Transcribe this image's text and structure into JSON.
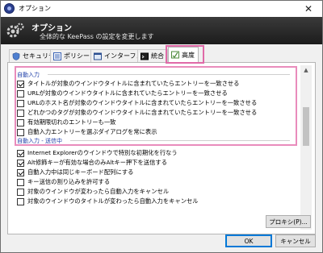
{
  "window": {
    "title": "オプション",
    "close_glyph": "✕"
  },
  "banner": {
    "title": "オプション",
    "subtitle": "全体的な KeePass の設定を変更します"
  },
  "tabs": [
    {
      "label": "セキュリティ",
      "icon": "shield-icon"
    },
    {
      "label": "ポリシー",
      "icon": "policy-icon"
    },
    {
      "label": "インターフェース",
      "icon": "interface-icon"
    },
    {
      "label": "統合",
      "icon": "integration-icon"
    },
    {
      "label": "高度",
      "icon": "advanced-icon",
      "active": true
    }
  ],
  "sections": {
    "auto_input": {
      "label": "自動入力",
      "options": [
        {
          "label": "タイトルが対象のウインドウタイトルに含まれていたらエントリーを一致させる",
          "checked": true
        },
        {
          "label": "URLが対象のウインドウタイトルに含まれていたらエントリーを一致させる",
          "checked": false
        },
        {
          "label": "URLのホスト名が対象のウインドウタイトルに含まれていたらエントリーを一致させる",
          "checked": false
        },
        {
          "label": "どれかつのタグが対象のウインドウタイトルに含まれていたらエントリーを一致させる",
          "checked": false
        },
        {
          "label": "有効期限切れのエントリーも一致",
          "checked": false
        },
        {
          "label": "自動入力エントリーを選ぶダイアログを常に表示",
          "checked": false
        }
      ]
    },
    "auto_input_send": {
      "label": "自動入力 - 送信中",
      "options": [
        {
          "label": "Internet Explorerのウインドウで特別な初期化を行なう",
          "checked": true
        },
        {
          "label": "Alt修飾キーが有効な場合のみAltキー押下を送信する",
          "checked": true
        },
        {
          "label": "自動入力中は同じキーボード配列にする",
          "checked": true
        },
        {
          "label": "キー送信の割り込みを許可する",
          "checked": false
        },
        {
          "label": "対象のウインドウが変わったら自動入力をキャンセル",
          "checked": false
        },
        {
          "label": "対象のウインドウのタイトルが変わったら自動入力をキャンセル",
          "checked": false
        }
      ]
    }
  },
  "buttons": {
    "proxy": "プロキシ(P)...",
    "ok": "OK",
    "cancel": "キャンセル"
  },
  "colors": {
    "highlight": "#e98cbc",
    "banner_bg": "#262626",
    "section_label": "#1e3ea8"
  }
}
